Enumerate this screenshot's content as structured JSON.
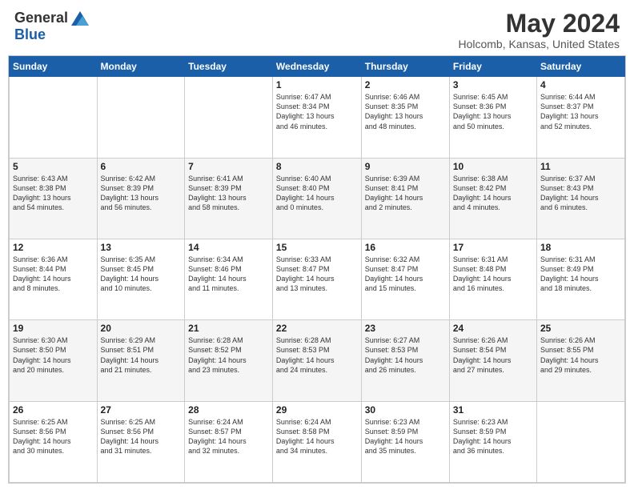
{
  "header": {
    "logo_general": "General",
    "logo_blue": "Blue",
    "month_title": "May 2024",
    "location": "Holcomb, Kansas, United States"
  },
  "calendar": {
    "days_of_week": [
      "Sunday",
      "Monday",
      "Tuesday",
      "Wednesday",
      "Thursday",
      "Friday",
      "Saturday"
    ],
    "weeks": [
      [
        {
          "day": "",
          "info": ""
        },
        {
          "day": "",
          "info": ""
        },
        {
          "day": "",
          "info": ""
        },
        {
          "day": "1",
          "info": "Sunrise: 6:47 AM\nSunset: 8:34 PM\nDaylight: 13 hours\nand 46 minutes."
        },
        {
          "day": "2",
          "info": "Sunrise: 6:46 AM\nSunset: 8:35 PM\nDaylight: 13 hours\nand 48 minutes."
        },
        {
          "day": "3",
          "info": "Sunrise: 6:45 AM\nSunset: 8:36 PM\nDaylight: 13 hours\nand 50 minutes."
        },
        {
          "day": "4",
          "info": "Sunrise: 6:44 AM\nSunset: 8:37 PM\nDaylight: 13 hours\nand 52 minutes."
        }
      ],
      [
        {
          "day": "5",
          "info": "Sunrise: 6:43 AM\nSunset: 8:38 PM\nDaylight: 13 hours\nand 54 minutes."
        },
        {
          "day": "6",
          "info": "Sunrise: 6:42 AM\nSunset: 8:39 PM\nDaylight: 13 hours\nand 56 minutes."
        },
        {
          "day": "7",
          "info": "Sunrise: 6:41 AM\nSunset: 8:39 PM\nDaylight: 13 hours\nand 58 minutes."
        },
        {
          "day": "8",
          "info": "Sunrise: 6:40 AM\nSunset: 8:40 PM\nDaylight: 14 hours\nand 0 minutes."
        },
        {
          "day": "9",
          "info": "Sunrise: 6:39 AM\nSunset: 8:41 PM\nDaylight: 14 hours\nand 2 minutes."
        },
        {
          "day": "10",
          "info": "Sunrise: 6:38 AM\nSunset: 8:42 PM\nDaylight: 14 hours\nand 4 minutes."
        },
        {
          "day": "11",
          "info": "Sunrise: 6:37 AM\nSunset: 8:43 PM\nDaylight: 14 hours\nand 6 minutes."
        }
      ],
      [
        {
          "day": "12",
          "info": "Sunrise: 6:36 AM\nSunset: 8:44 PM\nDaylight: 14 hours\nand 8 minutes."
        },
        {
          "day": "13",
          "info": "Sunrise: 6:35 AM\nSunset: 8:45 PM\nDaylight: 14 hours\nand 10 minutes."
        },
        {
          "day": "14",
          "info": "Sunrise: 6:34 AM\nSunset: 8:46 PM\nDaylight: 14 hours\nand 11 minutes."
        },
        {
          "day": "15",
          "info": "Sunrise: 6:33 AM\nSunset: 8:47 PM\nDaylight: 14 hours\nand 13 minutes."
        },
        {
          "day": "16",
          "info": "Sunrise: 6:32 AM\nSunset: 8:47 PM\nDaylight: 14 hours\nand 15 minutes."
        },
        {
          "day": "17",
          "info": "Sunrise: 6:31 AM\nSunset: 8:48 PM\nDaylight: 14 hours\nand 16 minutes."
        },
        {
          "day": "18",
          "info": "Sunrise: 6:31 AM\nSunset: 8:49 PM\nDaylight: 14 hours\nand 18 minutes."
        }
      ],
      [
        {
          "day": "19",
          "info": "Sunrise: 6:30 AM\nSunset: 8:50 PM\nDaylight: 14 hours\nand 20 minutes."
        },
        {
          "day": "20",
          "info": "Sunrise: 6:29 AM\nSunset: 8:51 PM\nDaylight: 14 hours\nand 21 minutes."
        },
        {
          "day": "21",
          "info": "Sunrise: 6:28 AM\nSunset: 8:52 PM\nDaylight: 14 hours\nand 23 minutes."
        },
        {
          "day": "22",
          "info": "Sunrise: 6:28 AM\nSunset: 8:53 PM\nDaylight: 14 hours\nand 24 minutes."
        },
        {
          "day": "23",
          "info": "Sunrise: 6:27 AM\nSunset: 8:53 PM\nDaylight: 14 hours\nand 26 minutes."
        },
        {
          "day": "24",
          "info": "Sunrise: 6:26 AM\nSunset: 8:54 PM\nDaylight: 14 hours\nand 27 minutes."
        },
        {
          "day": "25",
          "info": "Sunrise: 6:26 AM\nSunset: 8:55 PM\nDaylight: 14 hours\nand 29 minutes."
        }
      ],
      [
        {
          "day": "26",
          "info": "Sunrise: 6:25 AM\nSunset: 8:56 PM\nDaylight: 14 hours\nand 30 minutes."
        },
        {
          "day": "27",
          "info": "Sunrise: 6:25 AM\nSunset: 8:56 PM\nDaylight: 14 hours\nand 31 minutes."
        },
        {
          "day": "28",
          "info": "Sunrise: 6:24 AM\nSunset: 8:57 PM\nDaylight: 14 hours\nand 32 minutes."
        },
        {
          "day": "29",
          "info": "Sunrise: 6:24 AM\nSunset: 8:58 PM\nDaylight: 14 hours\nand 34 minutes."
        },
        {
          "day": "30",
          "info": "Sunrise: 6:23 AM\nSunset: 8:59 PM\nDaylight: 14 hours\nand 35 minutes."
        },
        {
          "day": "31",
          "info": "Sunrise: 6:23 AM\nSunset: 8:59 PM\nDaylight: 14 hours\nand 36 minutes."
        },
        {
          "day": "",
          "info": ""
        }
      ]
    ]
  }
}
